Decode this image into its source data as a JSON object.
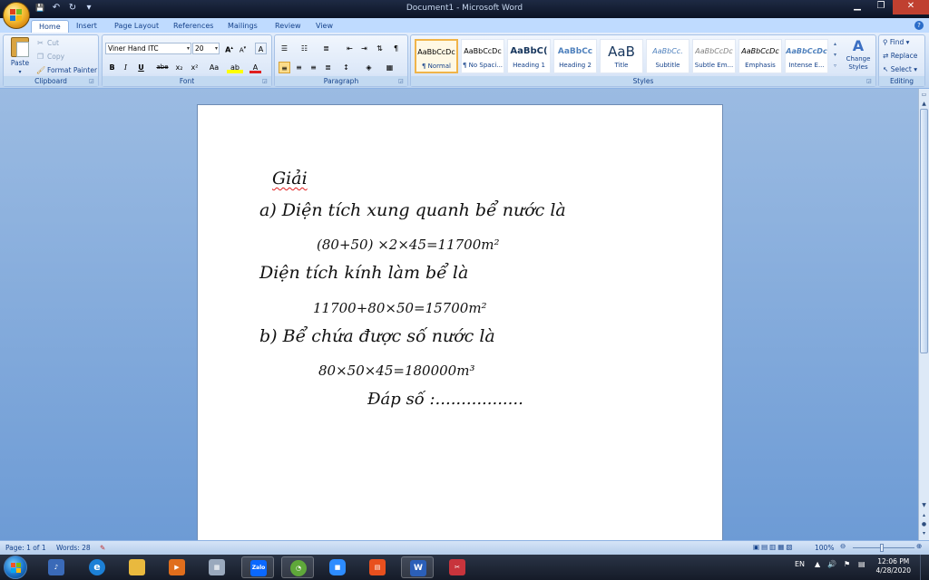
{
  "window": {
    "title": "Document1 - Microsoft Word",
    "controls": {
      "minimize": "▁",
      "maximize": "❐",
      "close": "✕"
    }
  },
  "qat": {
    "save": "💾",
    "undo": "↶",
    "redo": "↻",
    "customize": "▾"
  },
  "tabs": [
    "Home",
    "Insert",
    "Page Layout",
    "References",
    "Mailings",
    "Review",
    "View"
  ],
  "ribbon": {
    "clipboard": {
      "label": "Clipboard",
      "paste": "Paste",
      "cut": "Cut",
      "copy": "Copy",
      "format_painter": "Format Painter"
    },
    "font": {
      "label": "Font",
      "font_name": "Viner Hand ITC",
      "font_size": "20",
      "grow": "A",
      "shrink": "A",
      "clear": "A",
      "bold": "B",
      "italic": "I",
      "underline": "U",
      "strike": "abe",
      "subscript": "x₂",
      "superscript": "x²",
      "change_case": "Aa",
      "highlight": "ab",
      "font_color": "A"
    },
    "paragraph": {
      "label": "Paragraph"
    },
    "styles": {
      "label": "Styles",
      "items": [
        {
          "sample": "AaBbCcDc",
          "name": "¶ Normal"
        },
        {
          "sample": "AaBbCcDc",
          "name": "¶ No Spaci..."
        },
        {
          "sample": "AaBbC(",
          "name": "Heading 1"
        },
        {
          "sample": "AaBbCc",
          "name": "Heading 2"
        },
        {
          "sample": "AaB",
          "name": "Title"
        },
        {
          "sample": "AaBbCc.",
          "name": "Subtitle"
        },
        {
          "sample": "AaBbCcDc",
          "name": "Subtle Em..."
        },
        {
          "sample": "AaBbCcDc",
          "name": "Emphasis"
        },
        {
          "sample": "AaBbCcDc",
          "name": "Intense E..."
        }
      ],
      "change_styles": "Change Styles"
    },
    "editing": {
      "label": "Editing",
      "find": "Find",
      "replace": "Replace",
      "select": "Select"
    }
  },
  "document": {
    "lines": [
      "Giải",
      "a) Diện tích xung quanh bể nước là",
      "(80+50) ×2×45=11700m²",
      "Diện tích kính làm bể là",
      "11700+80×50=15700m²",
      "b) Bể chứa được số nước là",
      "80×50×45=180000m³",
      "Đáp số :................."
    ]
  },
  "status": {
    "page": "Page: 1 of 1",
    "words": "Words: 28",
    "zoom": "100%"
  },
  "tray": {
    "lang": "EN",
    "time": "12:06 PM",
    "date": "4/28/2020"
  },
  "taskbar": {
    "zalo": "Zalo"
  },
  "colors": {
    "ribbon_text": "#15428b",
    "accent": "#f0b44a"
  }
}
